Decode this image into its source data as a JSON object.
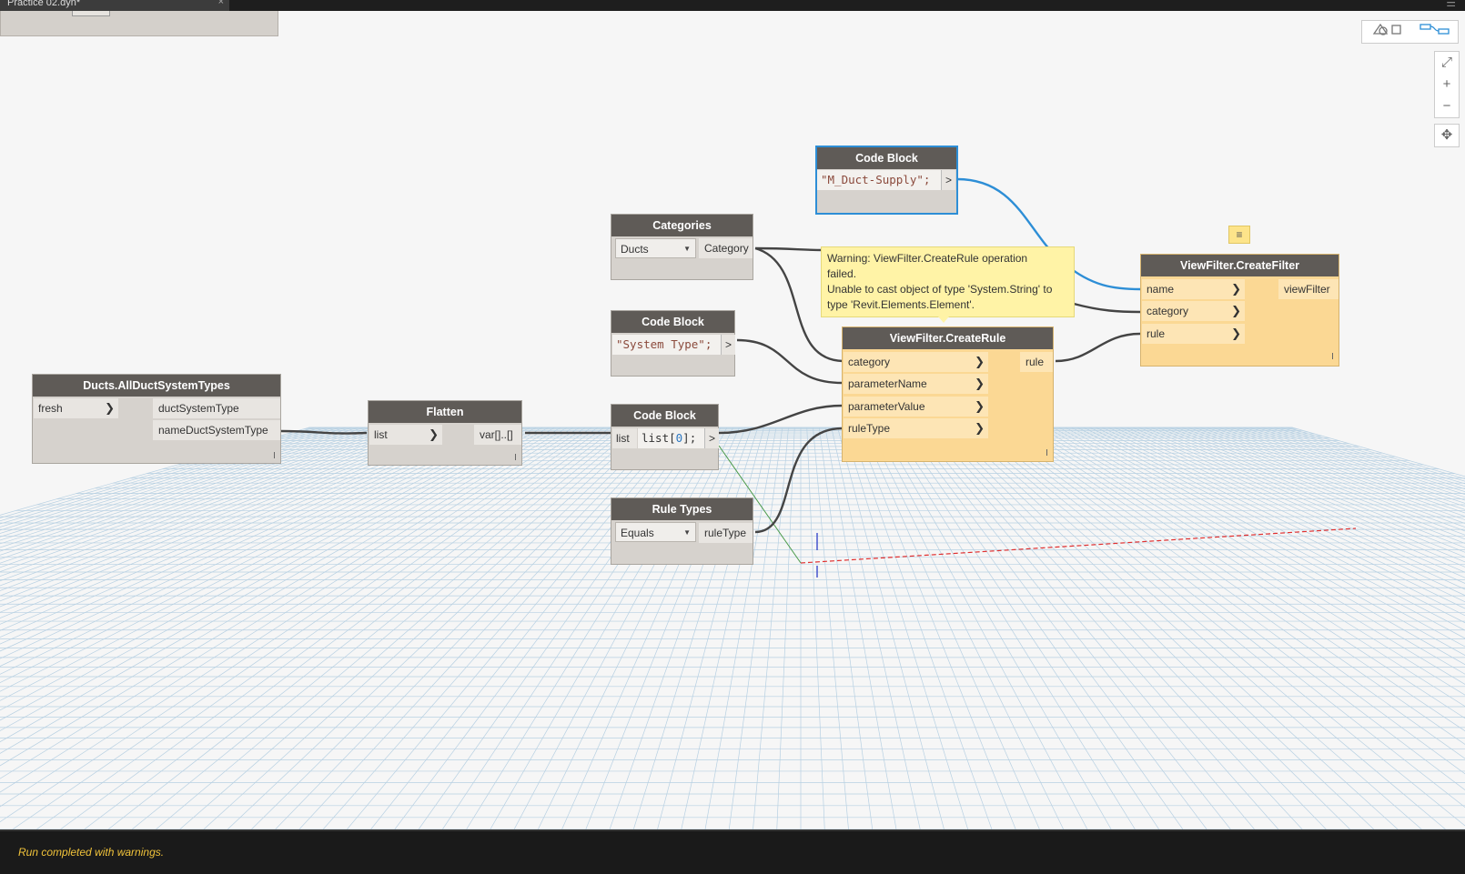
{
  "window": {
    "tab_title": "Practice 02.dyn*",
    "close_glyph": "×",
    "menu_glyph": "☰"
  },
  "view_toggle": {
    "geometry_icon": "geometry-view-icon",
    "graph_icon": "graph-view-icon"
  },
  "zoom": {
    "fit": "⤢",
    "zoom_in": "+",
    "zoom_out": "−",
    "pan": "✥"
  },
  "nodes": {
    "all_duct_system_types": {
      "title": "Ducts.AllDuctSystemTypes",
      "inputs": [
        "fresh"
      ],
      "outputs": [
        "ductSystemType",
        "nameDuctSystemType"
      ]
    },
    "flatten": {
      "title": "Flatten",
      "input": "list",
      "output": "var[]..[]"
    },
    "categories": {
      "title": "Categories",
      "selected": "Ducts",
      "output": "Category"
    },
    "code_block_system_type": {
      "title": "Code Block",
      "code": "\"System Type\";",
      "output": ">"
    },
    "code_block_list": {
      "title": "Code Block",
      "input": "list",
      "code_prefix": "list[",
      "code_index": "0",
      "code_suffix": "];",
      "output": ">"
    },
    "code_block_duct_supply": {
      "title": "Code Block",
      "code": "\"M_Duct-Supply\";",
      "output": ">"
    },
    "rule_types": {
      "title": "Rule Types",
      "selected": "Equals",
      "output": "ruleType"
    },
    "create_rule": {
      "title": "ViewFilter.CreateRule",
      "inputs": [
        "category",
        "parameterName",
        "parameterValue",
        "ruleType"
      ],
      "output": "rule"
    },
    "create_filter": {
      "title": "ViewFilter.CreateFilter",
      "inputs": [
        "name",
        "category",
        "rule"
      ],
      "output": "viewFilter"
    }
  },
  "warning": {
    "line1": "Warning: ViewFilter.CreateRule operation",
    "line2": "failed.",
    "line3": "Unable to cast object of type 'System.String' to",
    "line4": "type 'Revit.Elements.Element'."
  },
  "note_glyph": "≡",
  "status": {
    "message": "Run completed with warnings."
  },
  "colors": {
    "wire": "#444444",
    "wire_selected": "#2d8ed6",
    "node_warning": "#fbd894",
    "status_text": "#f0c23a"
  }
}
